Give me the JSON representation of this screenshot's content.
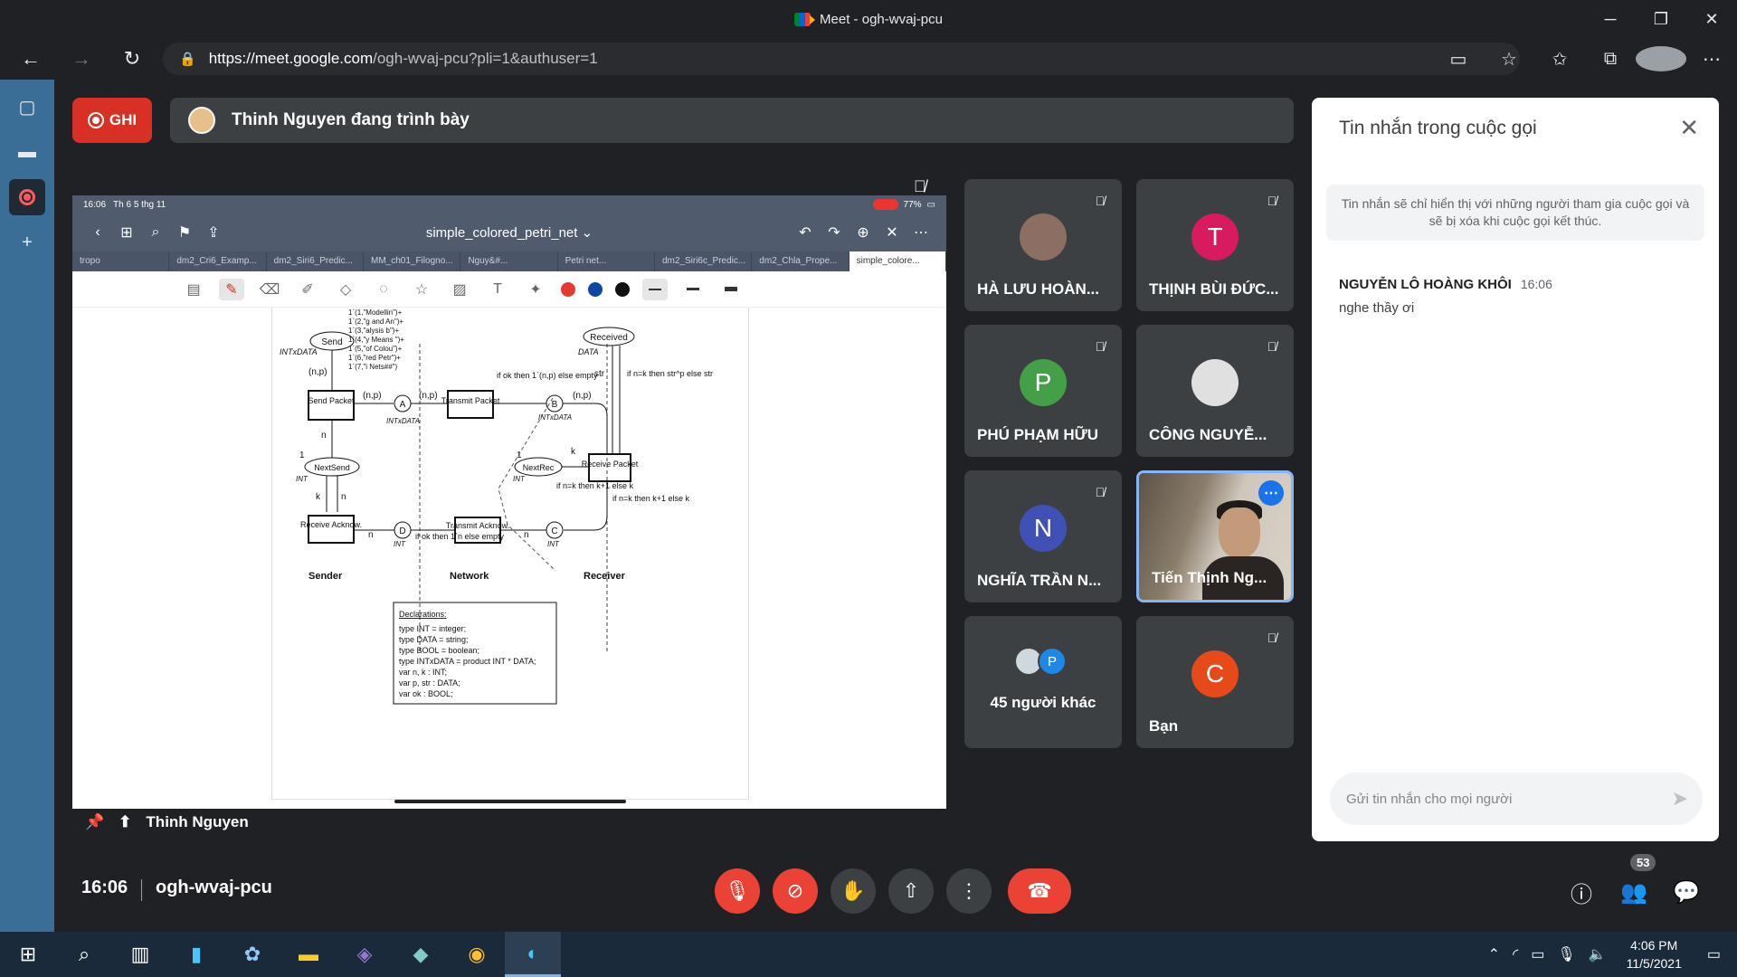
{
  "window": {
    "title": "Meet - ogh-wvaj-pcu"
  },
  "browser": {
    "url_host": "https://meet.google.com",
    "url_path": "/ogh-wvaj-pcu?pli=1&authuser=1"
  },
  "meet": {
    "rec_label": "GHI",
    "presenting_text": "Thinh Nguyen đang trình bày",
    "presenter_label": "Thinh Nguyen"
  },
  "presentation": {
    "status_time": "16:06",
    "status_date": "Th 6 5 thg 11",
    "battery": "77%",
    "doc_title": "simple_colored_petri_net ⌄",
    "tabs": [
      "tropo",
      "dm2_Cri6_Examp...",
      "dm2_Siri6_Predic...",
      "MM_ch01_Filogno...",
      "Nguy&#...",
      "Petri net...",
      "dm2_Siri6c_Predic...",
      "dm2_Chla_Prope...",
      "simple_colore..."
    ],
    "diagram": {
      "marks": "1`(1,\"Modellin\")+ 1`(2,\"g and An\")+ 1`(3,\"alysis b\")+ 1`(4,\"y Means \")+ 1`(5,\"of Colou\")+ 1`(6,\"red Petr\")+ 1`(7,\"i Nets##\")",
      "send": "Send",
      "intxdata": "INTxDATA",
      "np": "(n,p)",
      "send_packet": "Send Packet",
      "a": "A",
      "b": "B",
      "c": "C",
      "d": "D",
      "transmit_packet": "Transmit Packet",
      "ifok": "if ok then 1`(n,p) else empty",
      "received": "Received",
      "data": "DATA",
      "str": "str",
      "ifnk": "if n=k then str^p else str",
      "n": "n",
      "k": "k",
      "one": "1",
      "nextsend": "NextSend",
      "int": "INT",
      "nextrec": "NextRec",
      "receive_packet": "Receive Packet",
      "ifnk2": "if n=k then k+1 else k",
      "receive_ack": "Receive Acknow.",
      "transmit_ack": "Transmit Acknow.",
      "ifok2": "if ok then 1`n else empty",
      "sender": "Sender",
      "network": "Network",
      "receiver": "Receiver",
      "decl_title": "Declarations:",
      "decl": [
        "type INT = integer;",
        "type DATA = string;",
        "type BOOL = boolean;",
        "type INTxDATA = product INT * DATA;",
        "var n, k : INT;",
        "var p, str : DATA;",
        "var ok : BOOL;"
      ]
    }
  },
  "participants": [
    {
      "name": "HÀ LƯU HOÀN...",
      "avatar": "",
      "color": "#8d6e63",
      "muted": true
    },
    {
      "name": "THỊNH BÙI ĐỨC...",
      "avatar": "T",
      "color": "#d81b60",
      "muted": true
    },
    {
      "name": "PHÚ PHẠM HỮU",
      "avatar": "P",
      "color": "#43a047",
      "muted": true
    },
    {
      "name": "CÔNG NGUYỄ...",
      "avatar": "",
      "color": "#e0e0e0",
      "muted": true
    },
    {
      "name": "NGHĨA TRẦN N...",
      "avatar": "N",
      "color": "#3f51b5",
      "muted": true
    },
    {
      "name": "Tiến Thịnh Ng...",
      "avatar": "",
      "color": "",
      "muted": false
    },
    {
      "name": "45 người khác",
      "avatar": "P",
      "color": "#1e88e5",
      "muted": false
    },
    {
      "name": "Bạn",
      "avatar": "C",
      "color": "#e64a19",
      "muted": true
    }
  ],
  "chat": {
    "title": "Tin nhắn trong cuộc gọi",
    "notice": "Tin nhắn sẽ chỉ hiển thị với những người tham gia cuộc gọi và sẽ bị xóa khi cuộc gọi kết thúc.",
    "messages": [
      {
        "sender": "NGUYỄN LÔ HOÀNG KHÔI",
        "time": "16:06",
        "text": "nghe thầy ơi"
      }
    ],
    "input_placeholder": "Gửi tin nhắn cho mọi người"
  },
  "bottom": {
    "time": "16:06",
    "meeting_code": "ogh-wvaj-pcu",
    "participant_count": "53"
  },
  "taskbar": {
    "clock_time": "4:06 PM",
    "clock_date": "11/5/2021"
  }
}
